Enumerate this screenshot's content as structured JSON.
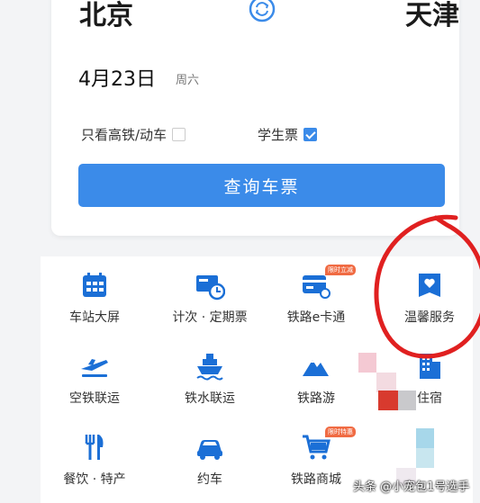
{
  "search": {
    "from_city": "北京",
    "to_city": "天津",
    "date": "4月23日",
    "weekday": "周六",
    "opt_highspeed": "只看高铁/动车",
    "opt_student": "学生票",
    "query_button": "查询车票"
  },
  "services": [
    {
      "label": "车站大屏",
      "icon": "calendar-grid-icon"
    },
    {
      "label": "计次 · 定期票",
      "icon": "ticket-clock-icon"
    },
    {
      "label": "铁路e卡通",
      "icon": "card-icon",
      "tag": "限时立减"
    },
    {
      "label": "温馨服务",
      "icon": "heart-box-icon"
    },
    {
      "label": "空铁联运",
      "icon": "plane-icon"
    },
    {
      "label": "铁水联运",
      "icon": "ship-icon"
    },
    {
      "label": "铁路游",
      "icon": "mountain-icon"
    },
    {
      "label": "住宿",
      "icon": "building-icon"
    },
    {
      "label": "餐饮 · 特产",
      "icon": "fork-knife-icon"
    },
    {
      "label": "约车",
      "icon": "car-icon"
    },
    {
      "label": "铁路商城",
      "icon": "cart-icon",
      "tag": "限时特惠"
    }
  ],
  "watermark": "头条 @小宠包1号选手",
  "colors": {
    "accent": "#3b8be9",
    "icon_blue": "#1b6fd6",
    "annotation": "#e02020"
  }
}
